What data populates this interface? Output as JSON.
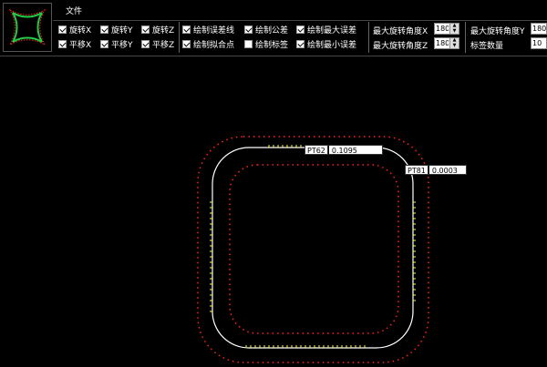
{
  "menu": {
    "file": "文件"
  },
  "checkboxes": {
    "rotate_x": {
      "label": "旋转X",
      "checked": true
    },
    "rotate_y": {
      "label": "旋转Y",
      "checked": true
    },
    "rotate_z": {
      "label": "旋转Z",
      "checked": true
    },
    "translate_x": {
      "label": "平移X",
      "checked": true
    },
    "translate_y": {
      "label": "平移Y",
      "checked": true
    },
    "translate_z": {
      "label": "平移Z",
      "checked": true
    },
    "draw_error_line": {
      "label": "绘制误差线",
      "checked": true
    },
    "draw_fit_points": {
      "label": "绘制拟合点",
      "checked": true
    },
    "draw_tolerance": {
      "label": "绘制公差",
      "checked": true
    },
    "draw_labels": {
      "label": "绘制标签",
      "checked": false
    },
    "draw_max_error": {
      "label": "绘制最大误差",
      "checked": true
    },
    "draw_min_error": {
      "label": "绘制最小误差",
      "checked": true
    }
  },
  "params": {
    "max_rot_x": {
      "label": "最大旋转角度X",
      "value": "180"
    },
    "max_rot_z": {
      "label": "最大旋转角度Z",
      "value": "180"
    },
    "max_rot_y": {
      "label": "最大旋转角度Y",
      "value": "180"
    },
    "label_count": {
      "label": "标签数量",
      "value": "10"
    }
  },
  "point_labels": [
    {
      "name": "PT62",
      "value": "0.1095"
    },
    {
      "name": "PT81",
      "value": "0.0003"
    }
  ],
  "colors": {
    "fit_curve": "#ffffff",
    "tolerance": "#ff2020",
    "error": "#ffff33",
    "logo_outline": "#22cc44"
  }
}
